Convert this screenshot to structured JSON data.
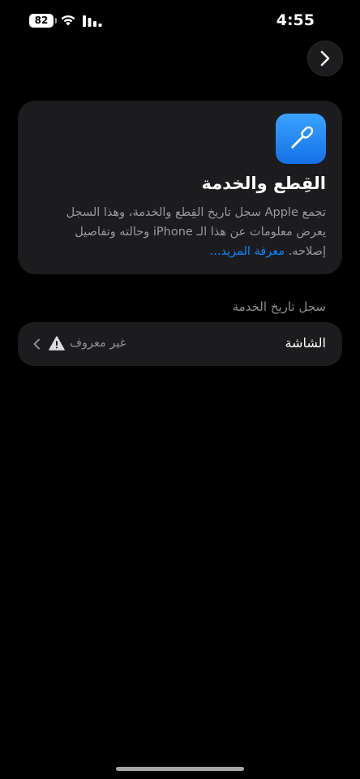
{
  "status_bar": {
    "battery_level": "82",
    "time": "4:55",
    "icons": [
      "wifi-icon",
      "cellular-signal-icon"
    ]
  },
  "nav": {
    "next_icon": "chevron-right-icon"
  },
  "info_card": {
    "icon": "screwdriver-icon",
    "icon_color": "#1a84ff",
    "title": "القِطع والخدمة",
    "body": "تجمع Apple سجل تاريخ القِطع والخدمة، وهذا السجل يعرض معلومات عن هذا الـ iPhone وحالته وتفاصيل إصلاحه.",
    "learn_more": "معرفة المزيد..."
  },
  "service_history": {
    "header": "سجل تاريخ الخدمة",
    "rows": [
      {
        "label": "الشاشة",
        "status": "غير معروف",
        "status_icon": "warning-triangle-icon"
      }
    ]
  },
  "colors": {
    "background": "#000000",
    "card": "#1c1c1e",
    "secondary_text": "#8e8e93",
    "link": "#0a84ff"
  }
}
